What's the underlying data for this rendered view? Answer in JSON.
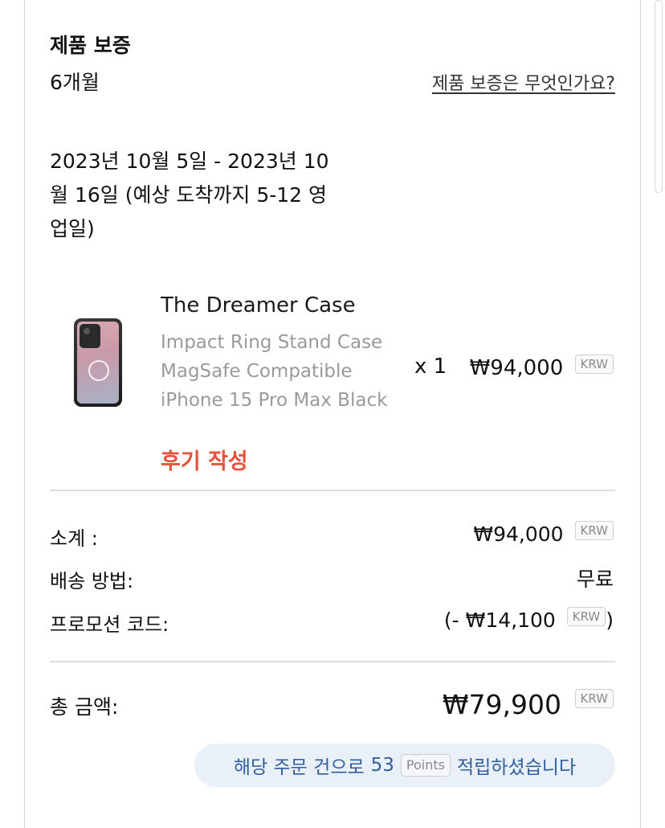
{
  "warranty": {
    "title": "제품 보증",
    "period": "6개월",
    "link": "제품 보증은 무엇인가요?"
  },
  "delivery": {
    "estimate": "2023년 10월 5일 - 2023년 10월 16일 (예상 도착까지 5-12 영업일)"
  },
  "product": {
    "name": "The Dreamer Case",
    "description": "Impact Ring Stand Case MagSafe Compatible iPhone 15 Pro Max Black",
    "review_link": "후기 작성",
    "quantity": "x 1",
    "price": "₩94,000",
    "currency": "KRW"
  },
  "summary": {
    "subtotal_label": "소계 :",
    "subtotal_value": "₩94,000",
    "subtotal_currency": "KRW",
    "shipping_label": "배송 방법:",
    "shipping_value": "무료",
    "promo_label": "프로모션 코드:",
    "promo_prefix": "(- ",
    "promo_value": "₩14,100",
    "promo_currency": "KRW",
    "promo_suffix": ")",
    "total_label": "총 금액:",
    "total_value": "₩79,900",
    "total_currency": "KRW"
  },
  "points": {
    "prefix": "해당 주문 건으로",
    "amount": "53",
    "unit": "Points",
    "suffix": "적립하셨습니다"
  },
  "colors": {
    "review_link": "#e5533d",
    "points_bg": "#eaf0f7",
    "points_text": "#2f5f9e"
  }
}
